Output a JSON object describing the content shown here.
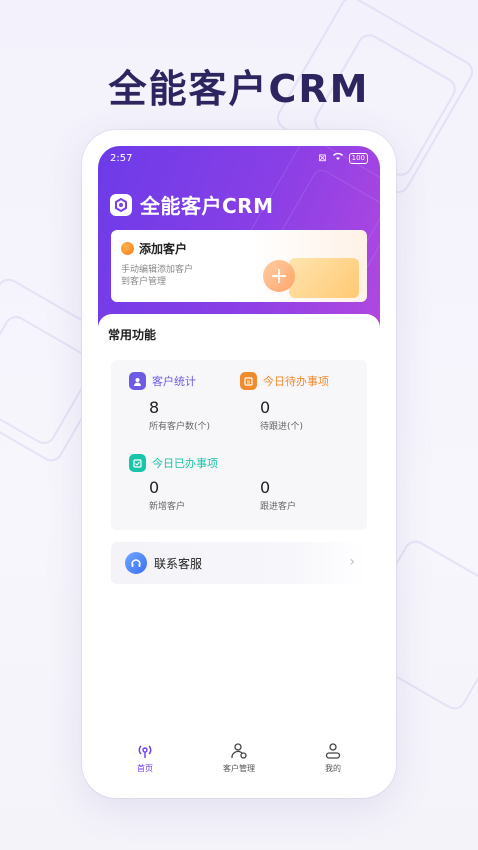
{
  "hero": {
    "title": "全能客户CRM"
  },
  "status_bar": {
    "time": "2:57",
    "battery": "100"
  },
  "brand": {
    "name": "全能客户CRM"
  },
  "add_card": {
    "title": "添加客户",
    "desc_line1": "手动编辑添加客户",
    "desc_line2": "到客户管理"
  },
  "section": {
    "title": "常用功能"
  },
  "functions": {
    "customer_stats": {
      "label": "客户统计",
      "value": "8",
      "sub": "所有客户数(个)"
    },
    "todo_today": {
      "label": "今日待办事项",
      "value": "0",
      "sub": "待跟进(个)"
    },
    "done_today": {
      "label": "今日已办事项"
    },
    "new_customers": {
      "value": "0",
      "sub": "新增客户"
    },
    "followup_customers": {
      "value": "0",
      "sub": "跟进客户"
    }
  },
  "service": {
    "label": "联系客服"
  },
  "tabs": [
    {
      "label": "首页",
      "icon": "home-signal-icon"
    },
    {
      "label": "客户管理",
      "icon": "user-manage-icon"
    },
    {
      "label": "我的",
      "icon": "user-icon"
    }
  ],
  "colors": {
    "accent": "#6c3be8",
    "stats_icon": "#6d5be6",
    "todo_icon": "#f08a2c",
    "done_icon": "#19c4a8"
  }
}
